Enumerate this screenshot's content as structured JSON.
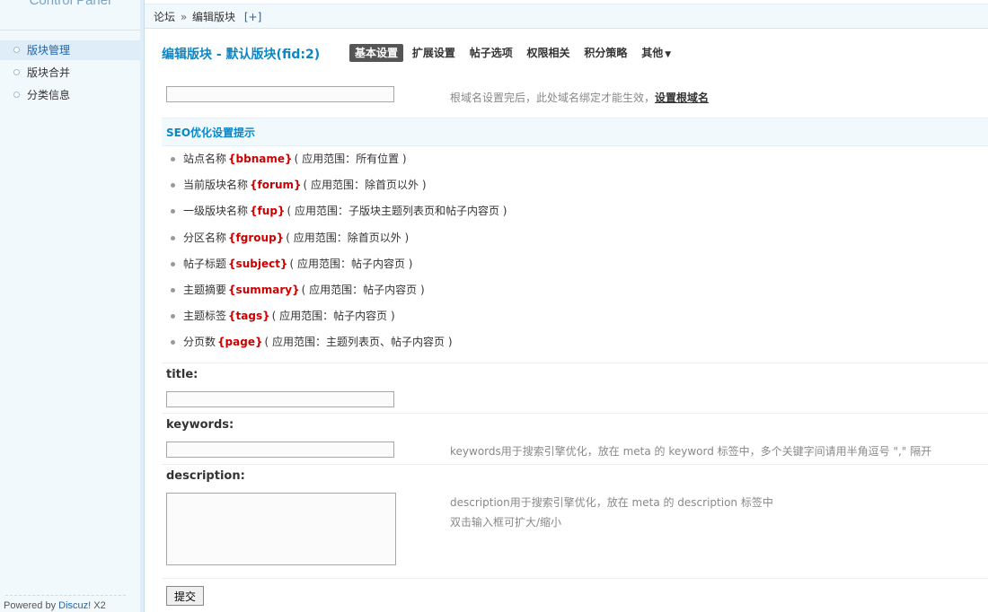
{
  "sidebar": {
    "title": "Control Panel",
    "items": [
      {
        "label": "版块管理",
        "active": true
      },
      {
        "label": "版块合并",
        "active": false
      },
      {
        "label": "分类信息",
        "active": false
      }
    ],
    "powered_prefix": "Powered by ",
    "powered_brand": "Discuz!",
    "powered_version": " X2"
  },
  "breadcrumb": {
    "root": "论坛",
    "separator": "»",
    "current": "编辑版块",
    "add": "[+]"
  },
  "header": {
    "title": "编辑版块 - 默认版块(fid:2)",
    "tabs": [
      {
        "label": "基本设置",
        "active": true
      },
      {
        "label": "扩展设置",
        "active": false
      },
      {
        "label": "帖子选项",
        "active": false
      },
      {
        "label": "权限相关",
        "active": false
      },
      {
        "label": "积分策略",
        "active": false
      },
      {
        "label": "其他",
        "active": false,
        "dropdown": true
      }
    ]
  },
  "domain": {
    "value": "",
    "hint": "根域名设置完后，此处域名绑定才能生效，",
    "link": "设置根域名"
  },
  "seo": {
    "header": "SEO优化设置提示",
    "items": [
      {
        "name": "站点名称",
        "var": "{bbname}",
        "scope": "( 应用范围：所有位置 )"
      },
      {
        "name": "当前版块名称",
        "var": "{forum}",
        "scope": "( 应用范围：除首页以外 )"
      },
      {
        "name": "一级版块名称",
        "var": "{fup}",
        "scope": "( 应用范围：子版块主题列表页和帖子内容页 )"
      },
      {
        "name": "分区名称",
        "var": "{fgroup}",
        "scope": "( 应用范围：除首页以外 )"
      },
      {
        "name": "帖子标题",
        "var": "{subject}",
        "scope": "( 应用范围：帖子内容页 )"
      },
      {
        "name": "主题摘要",
        "var": "{summary}",
        "scope": "( 应用范围：帖子内容页 )"
      },
      {
        "name": "主题标签",
        "var": "{tags}",
        "scope": "( 应用范围：帖子内容页 )"
      },
      {
        "name": "分页数",
        "var": "{page}",
        "scope": "( 应用范围：主题列表页、帖子内容页 )"
      }
    ]
  },
  "form": {
    "title_label": "title:",
    "title_value": "",
    "keywords_label": "keywords:",
    "keywords_value": "",
    "keywords_hint": "keywords用于搜索引擎优化，放在 meta 的 keyword 标签中，多个关键字间请用半角逗号 \",\" 隔开",
    "description_label": "description:",
    "description_value": "",
    "description_hint_1": "description用于搜索引擎优化，放在 meta 的 description 标签中",
    "description_hint_2": "双击输入框可扩大/缩小",
    "submit_label": "提交"
  },
  "colors": {
    "accent": "#0b87c6",
    "variable": "#cc0000",
    "sidebar_bg": "#f2f9fd"
  }
}
